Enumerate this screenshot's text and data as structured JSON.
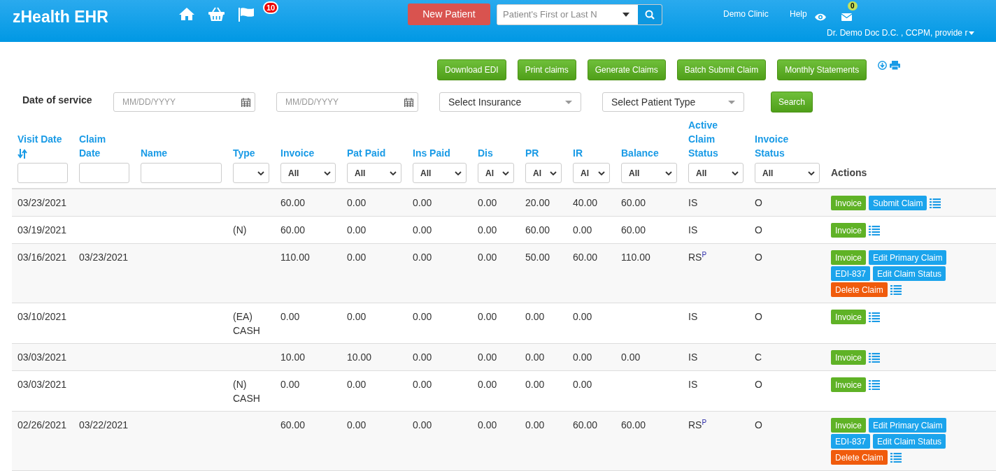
{
  "header": {
    "brand": "zHealth EHR",
    "flag_count": "10",
    "new_patient": "New Patient",
    "search": {
      "placeholder": "Patient's First or Last N"
    },
    "clinic": "Demo Clinic",
    "help": "Help",
    "mail_count": "0",
    "user": "Dr. Demo Doc D.C. , CCPM, provide r"
  },
  "toolbar": [
    "Download EDI",
    "Print claims",
    "Generate Claims",
    "Batch Submit Claim",
    "Monthly Statements"
  ],
  "filters": {
    "label": "Date of service",
    "dates": [
      {
        "placeholder": "MM/DD/YYYY"
      },
      {
        "placeholder": "MM/DD/YYYY"
      }
    ],
    "selects": [
      "Select Insurance",
      "Select Patient Type"
    ],
    "search": "Search"
  },
  "table": {
    "columns": [
      {
        "label": "Visit Date",
        "sortable": true,
        "filter": {
          "kind": "text"
        }
      },
      {
        "label": "Claim Date",
        "sortable": false,
        "filter": {
          "kind": "text"
        }
      },
      {
        "label": "Name",
        "sortable": false,
        "filter": {
          "kind": "text"
        }
      },
      {
        "label": "Type",
        "sortable": false,
        "filter": {
          "kind": "select"
        }
      },
      {
        "label": "Invoice",
        "sortable": false,
        "filter": {
          "kind": "select",
          "value": "All"
        }
      },
      {
        "label": "Pat Paid",
        "sortable": false,
        "filter": {
          "kind": "select",
          "value": "All"
        }
      },
      {
        "label": "Ins Paid",
        "sortable": false,
        "filter": {
          "kind": "select",
          "value": "All"
        }
      },
      {
        "label": "Dis",
        "sortable": false,
        "filter": {
          "kind": "select",
          "value": "Al"
        }
      },
      {
        "label": "PR",
        "sortable": false,
        "filter": {
          "kind": "select",
          "value": "Al"
        }
      },
      {
        "label": "IR",
        "sortable": false,
        "filter": {
          "kind": "select",
          "value": "Al"
        }
      },
      {
        "label": "Balance",
        "sortable": false,
        "filter": {
          "kind": "select",
          "value": "All"
        }
      },
      {
        "label": "Active Claim Status",
        "sortable": false,
        "filter": {
          "kind": "select",
          "value": "All"
        }
      },
      {
        "label": "Invoice Status",
        "sortable": false,
        "filter": {
          "kind": "select",
          "value": "All"
        }
      },
      {
        "label": "Actions",
        "sortable": false
      }
    ],
    "rows": [
      {
        "cells": [
          "03/23/2021",
          "",
          "",
          "",
          "60.00",
          "0.00",
          "0.00",
          "0.00",
          "20.00",
          "40.00",
          "60.00",
          "IS",
          "O"
        ],
        "actions": [
          {
            "kind": "invoice",
            "label": "Invoice"
          },
          {
            "kind": "primary",
            "label": "Submit Claim"
          },
          {
            "kind": "list"
          }
        ]
      },
      {
        "cells": [
          "03/19/2021",
          "",
          "",
          "(N)",
          "60.00",
          "0.00",
          "0.00",
          "0.00",
          "60.00",
          "0.00",
          "60.00",
          "IS",
          "O"
        ],
        "actions": [
          {
            "kind": "invoice",
            "label": "Invoice"
          },
          {
            "kind": "list"
          }
        ]
      },
      {
        "cells": [
          "03/16/2021",
          "03/23/2021",
          "",
          "",
          "110.00",
          "0.00",
          "0.00",
          "0.00",
          "50.00",
          "60.00",
          "110.00",
          "RS$^{P}$",
          "O"
        ],
        "actions": [
          {
            "kind": "invoice",
            "label": "Invoice"
          },
          {
            "kind": "primary",
            "label": "Edit Primary Claim"
          },
          {
            "kind": "primary",
            "label": "EDI-837"
          },
          {
            "kind": "primary",
            "label": "Edit Claim Status"
          },
          {
            "kind": "danger",
            "label": "Delete Claim"
          },
          {
            "kind": "list"
          }
        ]
      },
      {
        "cells": [
          "03/10/2021",
          "",
          "",
          "(EA) CASH",
          "0.00",
          "0.00",
          "0.00",
          "0.00",
          "0.00",
          "0.00",
          "",
          "IS",
          "O"
        ],
        "actions": [
          {
            "kind": "invoice",
            "label": "Invoice"
          },
          {
            "kind": "list"
          }
        ]
      },
      {
        "cells": [
          "03/03/2021",
          "",
          "",
          "",
          "10.00",
          "10.00",
          "0.00",
          "0.00",
          "0.00",
          "0.00",
          "0.00",
          "IS",
          "C"
        ],
        "actions": [
          {
            "kind": "invoice",
            "label": "Invoice"
          },
          {
            "kind": "list"
          }
        ]
      },
      {
        "cells": [
          "03/03/2021",
          "",
          "",
          "(N) CASH",
          "0.00",
          "0.00",
          "0.00",
          "0.00",
          "0.00",
          "0.00",
          "",
          "IS",
          "O"
        ],
        "actions": [
          {
            "kind": "invoice",
            "label": "Invoice"
          },
          {
            "kind": "list"
          }
        ]
      },
      {
        "cells": [
          "02/26/2021",
          "03/22/2021",
          "",
          "",
          "60.00",
          "0.00",
          "0.00",
          "0.00",
          "0.00",
          "60.00",
          "60.00",
          "RS$^{P}$",
          "O"
        ],
        "actions": [
          {
            "kind": "invoice",
            "label": "Invoice"
          },
          {
            "kind": "primary",
            "label": "Edit Primary Claim"
          },
          {
            "kind": "primary",
            "label": "EDI-837"
          },
          {
            "kind": "primary",
            "label": "Edit Claim Status"
          },
          {
            "kind": "danger",
            "label": "Delete Claim"
          },
          {
            "kind": "list"
          }
        ]
      }
    ]
  }
}
